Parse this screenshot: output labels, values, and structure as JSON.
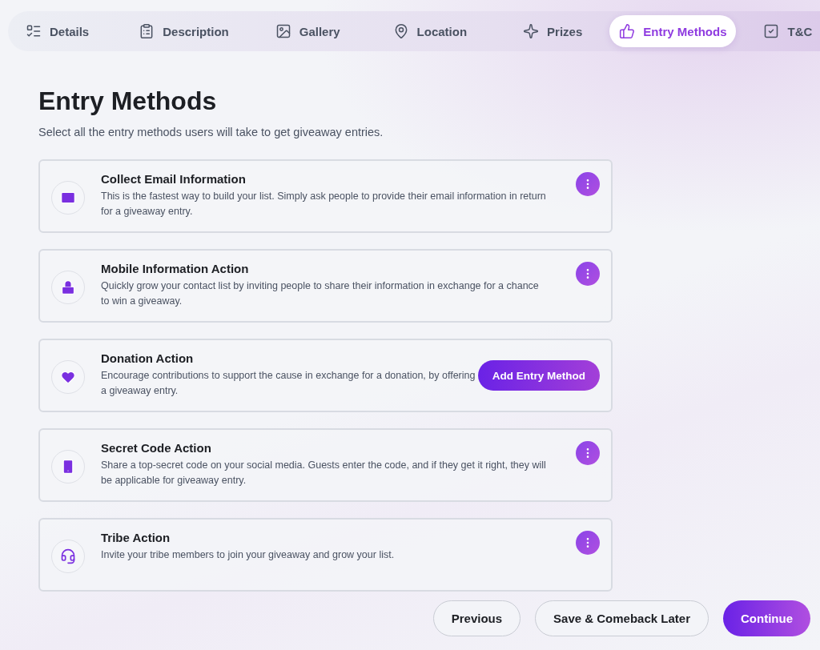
{
  "tabs": [
    {
      "label": "Details",
      "selected": false
    },
    {
      "label": "Description",
      "selected": false
    },
    {
      "label": "Gallery",
      "selected": false
    },
    {
      "label": "Location",
      "selected": false
    },
    {
      "label": "Prizes",
      "selected": false
    },
    {
      "label": "Entry Methods",
      "selected": true
    },
    {
      "label": "T&C",
      "selected": false
    }
  ],
  "heading": "Entry Methods",
  "subtitle": "Select all the entry methods users will take to get giveaway entries.",
  "methods": [
    {
      "title": "Collect Email Information",
      "description": "This is the fastest way to build your list. Simply ask people to provide their email information in return for a giveaway entry.",
      "action": {
        "kind": "menu"
      }
    },
    {
      "title": "Mobile Information Action",
      "description": "Quickly grow your contact list by inviting people to share their information in exchange for a chance to win a giveaway.",
      "action": {
        "kind": "menu"
      }
    },
    {
      "title": "Donation Action",
      "description": "Encourage contributions to support the cause in exchange for a donation, by offering a giveaway entry.",
      "action": {
        "kind": "add",
        "label": "Add Entry Method"
      }
    },
    {
      "title": "Secret Code Action",
      "description": "Share a top-secret code on your social media. Guests enter the code, and if they get it right, they will be applicable for giveaway entry.",
      "action": {
        "kind": "menu"
      }
    },
    {
      "title": "Tribe Action",
      "description": "Invite your tribe members to join your giveaway and grow your list.",
      "action": {
        "kind": "menu"
      }
    }
  ],
  "footer": [
    {
      "label": "Previous",
      "kind": "secondary"
    },
    {
      "label": "Save & Comeback Later",
      "kind": "secondary"
    },
    {
      "label": "Continue",
      "kind": "primary"
    }
  ]
}
